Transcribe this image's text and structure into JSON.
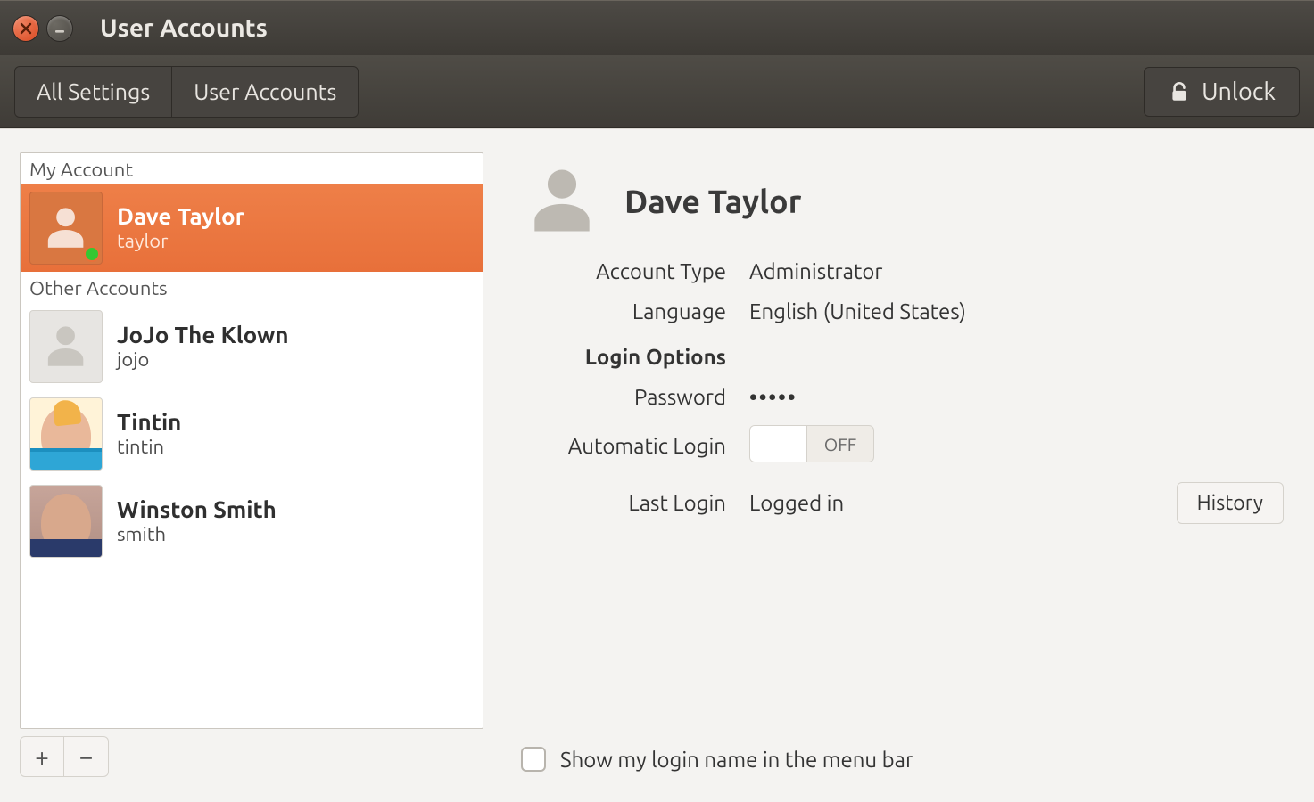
{
  "window": {
    "title": "User Accounts"
  },
  "toolbar": {
    "all_settings": "All Settings",
    "breadcrumb_current": "User Accounts",
    "unlock": "Unlock"
  },
  "sidebar": {
    "my_account_header": "My Account",
    "other_accounts_header": "Other Accounts",
    "my_account": {
      "name": "Dave Taylor",
      "login": "taylor",
      "online": true
    },
    "others": [
      {
        "name": "JoJo The Klown",
        "login": "jojo",
        "avatar": "silhouette"
      },
      {
        "name": "Tintin",
        "login": "tintin",
        "avatar": "tintin"
      },
      {
        "name": "Winston Smith",
        "login": "smith",
        "avatar": "winston"
      }
    ],
    "add_tooltip": "+",
    "remove_tooltip": "−"
  },
  "details": {
    "name": "Dave Taylor",
    "labels": {
      "account_type": "Account Type",
      "language": "Language",
      "login_options": "Login Options",
      "password": "Password",
      "automatic_login": "Automatic Login",
      "last_login": "Last Login"
    },
    "values": {
      "account_type": "Administrator",
      "language": "English (United States)",
      "password": "•••••",
      "automatic_login_state": "OFF",
      "last_login": "Logged in"
    },
    "history_button": "History",
    "show_login_name_checkbox": "Show my login name in the menu bar",
    "show_login_name_checked": false
  }
}
